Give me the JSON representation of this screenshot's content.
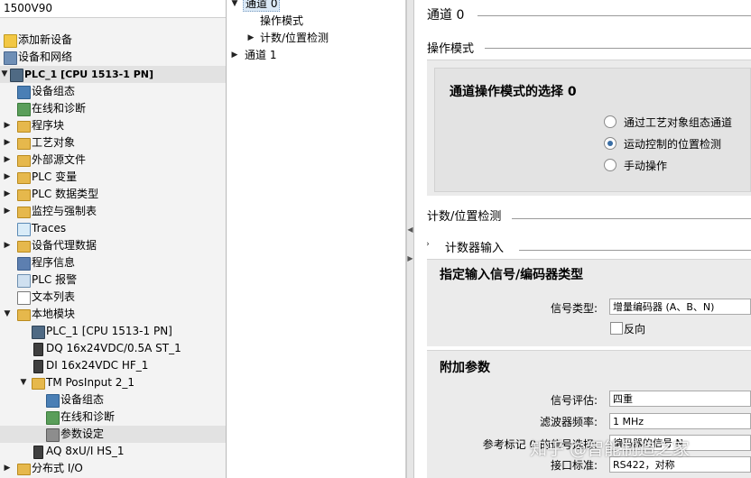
{
  "project_tree": {
    "root_label": "1500V90",
    "items": [
      {
        "label": "添加新设备",
        "icon": "add-device-icon"
      },
      {
        "label": "设备和网络",
        "icon": "network-icon"
      },
      {
        "label": "PLC_1 [CPU 1513-1 PN]",
        "icon": "cpu-icon"
      },
      {
        "label": "设备组态",
        "icon": "device-config-icon"
      },
      {
        "label": "在线和诊断",
        "icon": "online-diagnostics-icon"
      },
      {
        "label": "程序块",
        "icon": "folder-icon"
      },
      {
        "label": "工艺对象",
        "icon": "folder-icon"
      },
      {
        "label": "外部源文件",
        "icon": "folder-icon"
      },
      {
        "label": "PLC 变量",
        "icon": "folder-icon"
      },
      {
        "label": "PLC 数据类型",
        "icon": "folder-icon"
      },
      {
        "label": "监控与强制表",
        "icon": "folder-icon"
      },
      {
        "label": "Traces",
        "icon": "traces-icon"
      },
      {
        "label": "设备代理数据",
        "icon": "folder-icon"
      },
      {
        "label": "程序信息",
        "icon": "program-info-icon"
      },
      {
        "label": "PLC 报警",
        "icon": "plc-alarm-icon"
      },
      {
        "label": "文本列表",
        "icon": "text-list-icon"
      },
      {
        "label": "本地模块",
        "icon": "folder-icon"
      },
      {
        "label": "PLC_1 [CPU 1513-1 PN]",
        "icon": "cpu-icon"
      },
      {
        "label": "DQ 16x24VDC/0.5A ST_1",
        "icon": "module-icon"
      },
      {
        "label": "DI 16x24VDC HF_1",
        "icon": "module-icon"
      },
      {
        "label": "TM PosInput 2_1",
        "icon": "folder-icon"
      },
      {
        "label": "设备组态",
        "icon": "device-config-icon"
      },
      {
        "label": "在线和诊断",
        "icon": "online-diagnostics-icon"
      },
      {
        "label": "参数设定",
        "icon": "parameter-icon"
      },
      {
        "label": "AQ 8xU/I HS_1",
        "icon": "module-icon"
      },
      {
        "label": "分布式 I/O",
        "icon": "folder-icon"
      }
    ]
  },
  "navigation": {
    "channel0": "通道 0",
    "operating_mode": "操作模式",
    "count_position": "计数/位置检测",
    "channel1": "通道 1"
  },
  "properties": {
    "channel_title": "通道 0",
    "operating_mode_section": "操作模式",
    "mode_group_title": "通道操作模式的选择 0",
    "mode_options": [
      {
        "label": "通过工艺对象组态通道",
        "checked": false
      },
      {
        "label": "运动控制的位置检测",
        "checked": true
      },
      {
        "label": "手动操作",
        "checked": false
      }
    ],
    "count_section": "计数/位置检测",
    "counter_input": "计数器输入",
    "signal_group_title": "指定输入信号/编码器类型",
    "signal_type_label": "信号类型:",
    "signal_type_value": "增量编码器 (A、B、N)",
    "reverse_label": "反向",
    "extra_group_title": "附加参数",
    "signal_eval_label": "信号评估:",
    "signal_eval_value": "四重",
    "filter_label": "滤波器频率:",
    "filter_value": "1 MHz",
    "ref_label": "参考标记 0 的信号选择:",
    "ref_value": "编码器的信号 N",
    "interface_label": "接口标准:",
    "interface_value": "RS422，对称"
  },
  "watermark": "知乎 @智能制造之家"
}
